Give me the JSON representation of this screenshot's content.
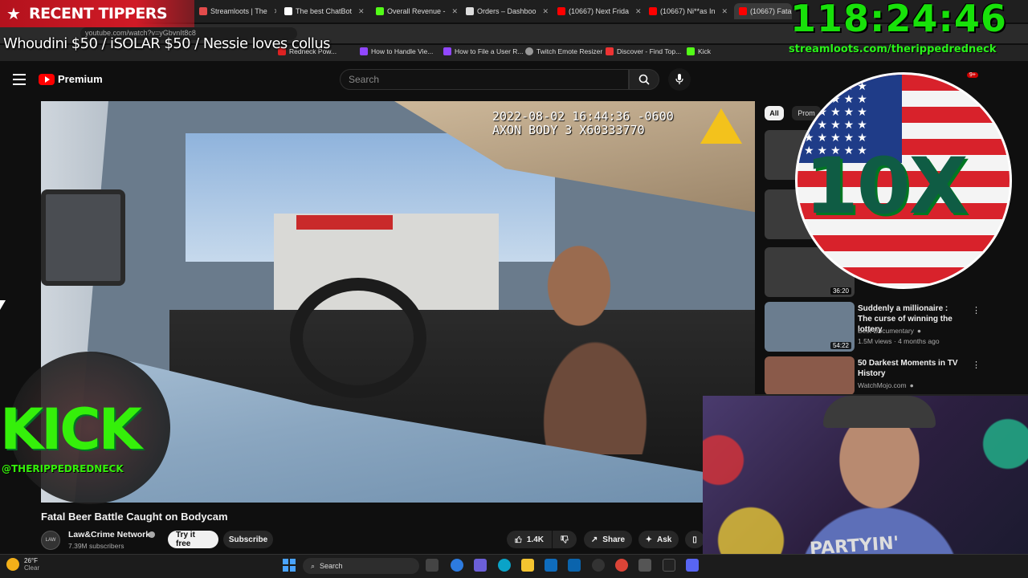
{
  "browser": {
    "tabs": [
      {
        "label": "Streamloots | The",
        "color": "#e24b4b"
      },
      {
        "label": "The best ChatBot",
        "color": "#ffffff"
      },
      {
        "label": "Overall Revenue -",
        "color": "#53fc18"
      },
      {
        "label": "Orders – Dashboo",
        "color": "#ffffff"
      },
      {
        "label": "(10667) Next Frida",
        "color": "#ff0000"
      },
      {
        "label": "(10667) Ni**as In",
        "color": "#ff0000"
      },
      {
        "label": "(10667) Fatal Bee",
        "color": "#ff0000"
      }
    ],
    "url": "youtube.com/watch?v=yGbvnIt8c8",
    "bookmarks": [
      {
        "label": "Redneck Pow...",
        "icon": "red-dot"
      },
      {
        "label": "How to Handle Vie...",
        "icon": "purple-icon"
      },
      {
        "label": "How to File a User R...",
        "icon": "purple-icon"
      },
      {
        "label": "Twitch Emote Resizer",
        "icon": "globe-icon"
      },
      {
        "label": "Discover - Find Top...",
        "icon": "red-icon"
      },
      {
        "label": "Kick",
        "icon": "kick-icon"
      }
    ]
  },
  "overlay": {
    "recent_tippers_label": "RECENT TIPPERS",
    "tipper_line": "Whoudini $50 / iSOLAR $50 / Nessie loves collus",
    "timer": "118:24:46",
    "streamloots_url": "streamloots.com/therippedredneck",
    "kick_logo_text": "KICK",
    "kick_handle": "@THERIPPEDREDNECK",
    "flag_logo_text": "10X",
    "webcam_shirt_text": "PARTYIN'"
  },
  "youtube": {
    "logo_label": "Premium",
    "search_placeholder": "Search",
    "notification_count": "9+",
    "video": {
      "timestamp_line1": "2022-08-02 16:44:36 -0600",
      "timestamp_line2": "AXON BODY 3 X60333770",
      "title": "Fatal Beer Battle Caught on Bodycam",
      "channel_name": "Law&Crime Network",
      "channel_avatar_text": "LAW CRIME",
      "subscribers": "7.39M subscribers",
      "try_label": "Try it free",
      "subscribe_label": "Subscribe",
      "like_count": "1.4K",
      "share_label": "Share",
      "ask_label": "Ask"
    },
    "chips": {
      "all": "All",
      "second": "Prom"
    },
    "recommendations": [
      {
        "duration": "36:20",
        "title": "",
        "channel": "",
        "meta": ""
      },
      {
        "duration": "54:22",
        "title": "Suddenly a millionaire : The curse of winning the lottery",
        "channel": "Best Documentary",
        "meta": "1.5M views · 4 months ago"
      },
      {
        "duration": "",
        "title": "50 Darkest Moments in TV History",
        "channel": "WatchMojo.com",
        "meta": ""
      }
    ]
  },
  "taskbar": {
    "temperature": "26°F",
    "condition": "Clear",
    "search_label": "Search"
  }
}
